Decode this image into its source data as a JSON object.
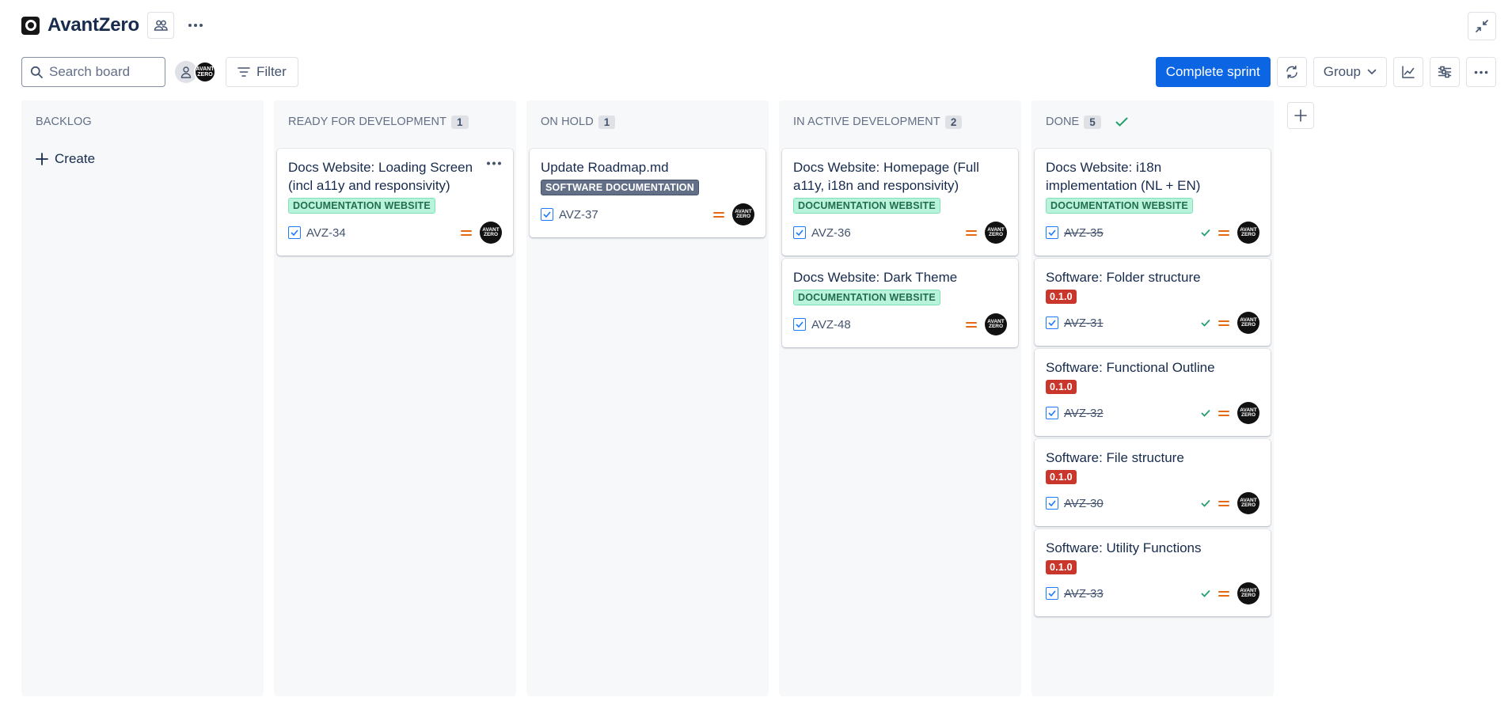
{
  "app": {
    "title": "AvantZero"
  },
  "toolbar": {
    "search_placeholder": "Search board",
    "filter_label": "Filter",
    "complete_label": "Complete sprint",
    "group_label": "Group"
  },
  "avatar_text": "AVANT ZERO",
  "columns": [
    {
      "title": "BACKLOG",
      "count": "",
      "create_label": "Create",
      "cards": []
    },
    {
      "title": "READY FOR DEVELOPMENT",
      "count": "1",
      "cards": [
        {
          "title": "Docs Website: Loading Screen (incl a11y and responsivity)",
          "label": "DOCUMENTATION WEBSITE",
          "key": "AVZ-34"
        }
      ]
    },
    {
      "title": "ON HOLD",
      "count": "1",
      "cards": [
        {
          "title": "Update Roadmap.md",
          "label": "SOFTWARE DOCUMENTATION",
          "key": "AVZ-37"
        }
      ]
    },
    {
      "title": "IN ACTIVE DEVELOPMENT",
      "count": "2",
      "cards": [
        {
          "title": "Docs Website: Homepage (Full a11y, i18n and responsivity)",
          "label": "DOCUMENTATION WEBSITE",
          "key": "AVZ-36"
        },
        {
          "title": "Docs Website: Dark Theme",
          "label": "DOCUMENTATION WEBSITE",
          "key": "AVZ-48"
        }
      ]
    },
    {
      "title": "DONE",
      "count": "5",
      "cards": [
        {
          "title": "Docs Website: i18n implementation (NL + EN)",
          "label": "DOCUMENTATION WEBSITE",
          "key": "AVZ-35"
        },
        {
          "title": "Software: Folder structure",
          "label": "0.1.0",
          "key": "AVZ-31"
        },
        {
          "title": "Software: Functional Outline",
          "label": "0.1.0",
          "key": "AVZ-32"
        },
        {
          "title": "Software: File structure",
          "label": "0.1.0",
          "key": "AVZ-30"
        },
        {
          "title": "Software: Utility Functions",
          "label": "0.1.0",
          "key": "AVZ-33"
        }
      ]
    }
  ],
  "colors": {
    "primary": "#0c66e4",
    "label_green_bg": "#baf3db",
    "label_red_bg": "#c9372c",
    "label_gray_bg": "#626f86",
    "priority": "#e56910",
    "done": "#22a06b"
  }
}
